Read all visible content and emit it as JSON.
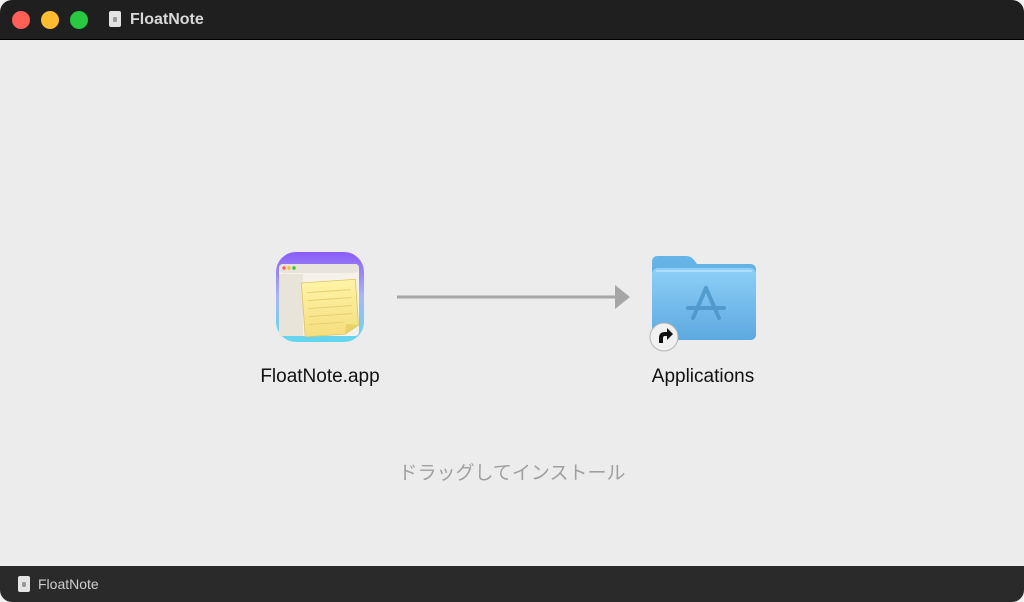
{
  "window": {
    "title": "FloatNote",
    "title_icon": "document-icon",
    "buttons": [
      "close",
      "minimize",
      "zoom"
    ]
  },
  "app": {
    "label": "FloatNote.app",
    "icon": "floatnote-app-icon"
  },
  "applications": {
    "label": "Applications",
    "icon": "applications-folder-icon",
    "badge": "alias-arrow-icon"
  },
  "instruction": "ドラッグしてインストール",
  "statusbar": {
    "label": "FloatNote",
    "icon": "document-icon"
  },
  "colors": {
    "titlebar": "#1f1f1f",
    "content_background": "#ececec",
    "folder_blue": "#6ab8ec",
    "arrow_gray": "#a6a6a6",
    "instruction_gray": "#a0a0a0"
  }
}
